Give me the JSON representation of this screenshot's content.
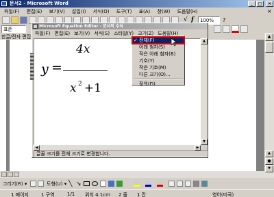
{
  "word": {
    "title": "문서2 - Microsoft Word",
    "menu": [
      "파일(F)",
      "편집(E)",
      "보기(V)",
      "삽입(I)",
      "서식(O)",
      "도구(T)",
      "표(A)",
      "창(W)",
      "도움말(H)"
    ],
    "style_value": "표준",
    "zoom": "100%",
    "ruler_label": "한글/전자 편집"
  },
  "eq": {
    "title": "Microsoft Equation Editor - 문서의 수식",
    "menu": [
      "파일(F)",
      "편집(E)",
      "보기(V)",
      "서식(S)",
      "스타일(Y)",
      "크기(Z)",
      "도움말(H)"
    ],
    "status": "글꼴 크기를 전체 크기로 변경합니다.",
    "eq_y": "y",
    "eq_eq": "=",
    "eq_num": "4x",
    "eq_den_x": "x",
    "eq_den_exp": "2",
    "eq_den_rest": "+1"
  },
  "size_menu": {
    "checkmark": "✓",
    "items": [
      "전체(F)",
      "아래 첨자(S)",
      "작은 아래 첨자(B)",
      "기호(Y)",
      "작은 기호(M)",
      "다른 크기(O)...",
      "정의(D)..."
    ],
    "selected_index": 0
  },
  "drawing": {
    "draw_label": "그리기(R) ▾",
    "autoshapes_label": "도형(U) ▾"
  },
  "statusbar": {
    "page": "1 페이지",
    "section": "1 구역",
    "pages": "1/1",
    "position": "위치 4.1cm",
    "line": "2 줄",
    "column": "1 칸",
    "language": "영어(미국)"
  },
  "colors": {
    "title_blue": "#0a246a",
    "highlight": "#0a246a",
    "red_border": "#e00000"
  }
}
